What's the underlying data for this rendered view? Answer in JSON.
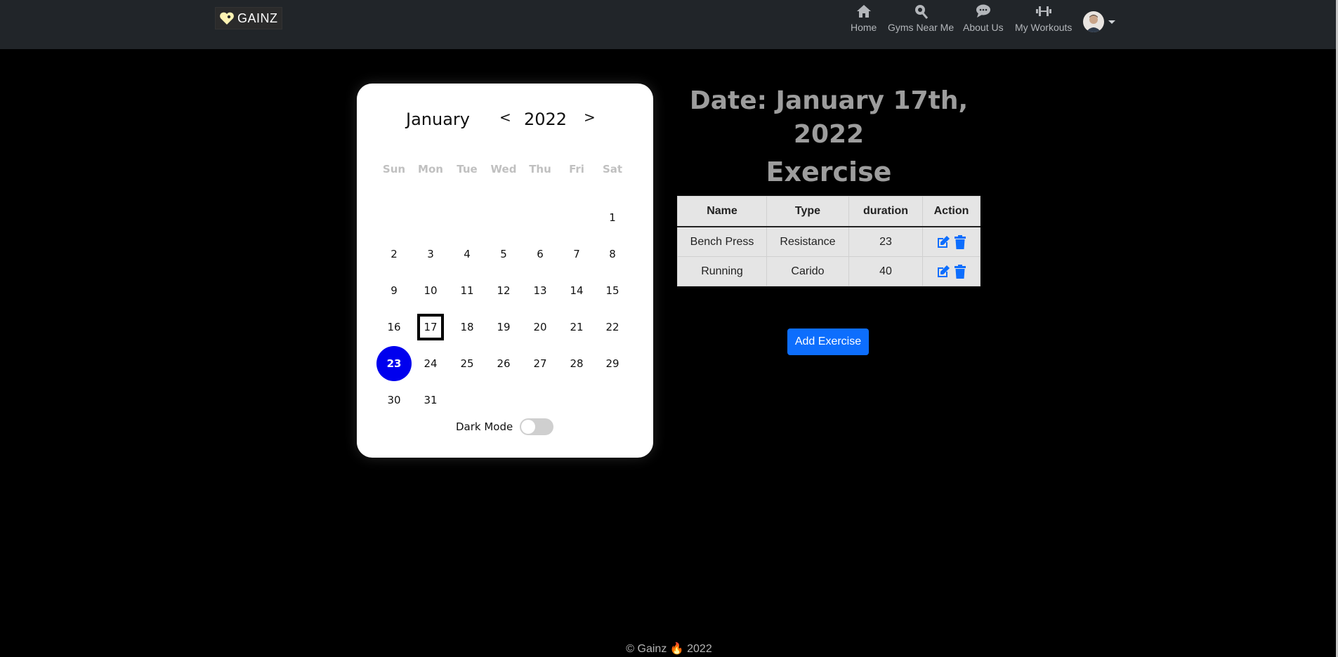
{
  "brand": {
    "name": "GAINZ"
  },
  "nav": {
    "items": [
      {
        "label": "Home",
        "icon": "home-icon"
      },
      {
        "label": "Gyms Near Me",
        "icon": "map-pin-icon"
      },
      {
        "label": "About Us",
        "icon": "chat-icon"
      },
      {
        "label": "My Workouts",
        "icon": "dumbbell-icon"
      }
    ]
  },
  "calendar": {
    "month": "January",
    "year": "2022",
    "prev": "<",
    "next": ">",
    "weekdays": [
      "Sun",
      "Mon",
      "Tue",
      "Wed",
      "Thu",
      "Fri",
      "Sat"
    ],
    "days": [
      "1",
      "2",
      "3",
      "4",
      "5",
      "6",
      "7",
      "8",
      "9",
      "10",
      "11",
      "12",
      "13",
      "14",
      "15",
      "16",
      "17",
      "18",
      "19",
      "20",
      "21",
      "22",
      "23",
      "24",
      "25",
      "26",
      "27",
      "28",
      "29",
      "30",
      "31"
    ],
    "selected_day": "17",
    "today_day": "23",
    "dark_mode_label": "Dark Mode",
    "dark_mode_on": false
  },
  "detail": {
    "date_line1": "Date: January 17th,",
    "date_line2": "2022",
    "exercise_title": "Exercise",
    "columns": [
      "Name",
      "Type",
      "duration",
      "Action"
    ],
    "rows": [
      {
        "name": "Bench Press",
        "type": "Resistance",
        "duration": "23"
      },
      {
        "name": "Running",
        "type": "Carido",
        "duration": "40"
      }
    ],
    "add_button": "Add Exercise"
  },
  "footer": {
    "text": "© Gainz 🔥 2022"
  },
  "colors": {
    "accent": "#0d6efd",
    "today": "#0000ee",
    "navbar": "#212529"
  }
}
